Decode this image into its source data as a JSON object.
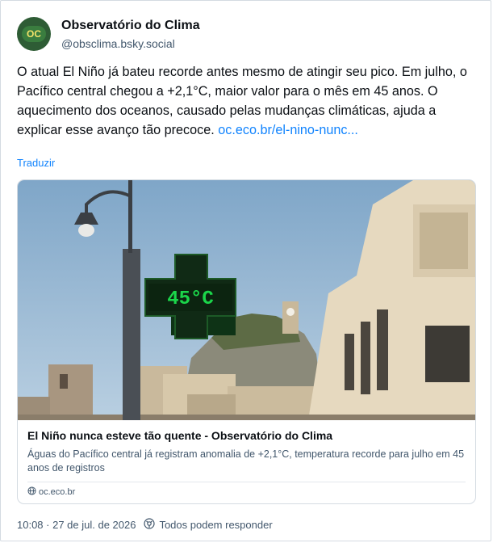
{
  "author": {
    "avatar_text": "OC",
    "display_name": "Observatório do Clima",
    "handle": "@obsclima.bsky.social"
  },
  "post": {
    "text": "O atual El Niño já bateu recorde antes mesmo de atingir seu pico. Em julho, o Pacífico central chegou a +2,1°C, maior valor para o mês em 45 anos. O aquecimento dos oceanos, causado pelas mudanças climáticas, ajuda a explicar esse avanço tão precoce. ",
    "link_text": "oc.eco.br/el-nino-nunc...",
    "translate_label": "Traduzir"
  },
  "link_card": {
    "image_sign_text": "45°C",
    "title": "El Niño nunca esteve tão quente - Observatório do Clima",
    "description": "Águas do Pacífico central já registram anomalia de +2,1°C, temperatura recorde para julho em 45 anos de registros",
    "domain": "oc.eco.br"
  },
  "meta": {
    "timestamp": "10:08 · 27 de jul. de 2026",
    "reply_setting": "Todos podem responder"
  },
  "colors": {
    "link": "#1083fe",
    "muted": "#42576c",
    "border": "#d4dbe2",
    "avatar_bg": "#2e5c35",
    "sign_green": "#1bd64a"
  }
}
